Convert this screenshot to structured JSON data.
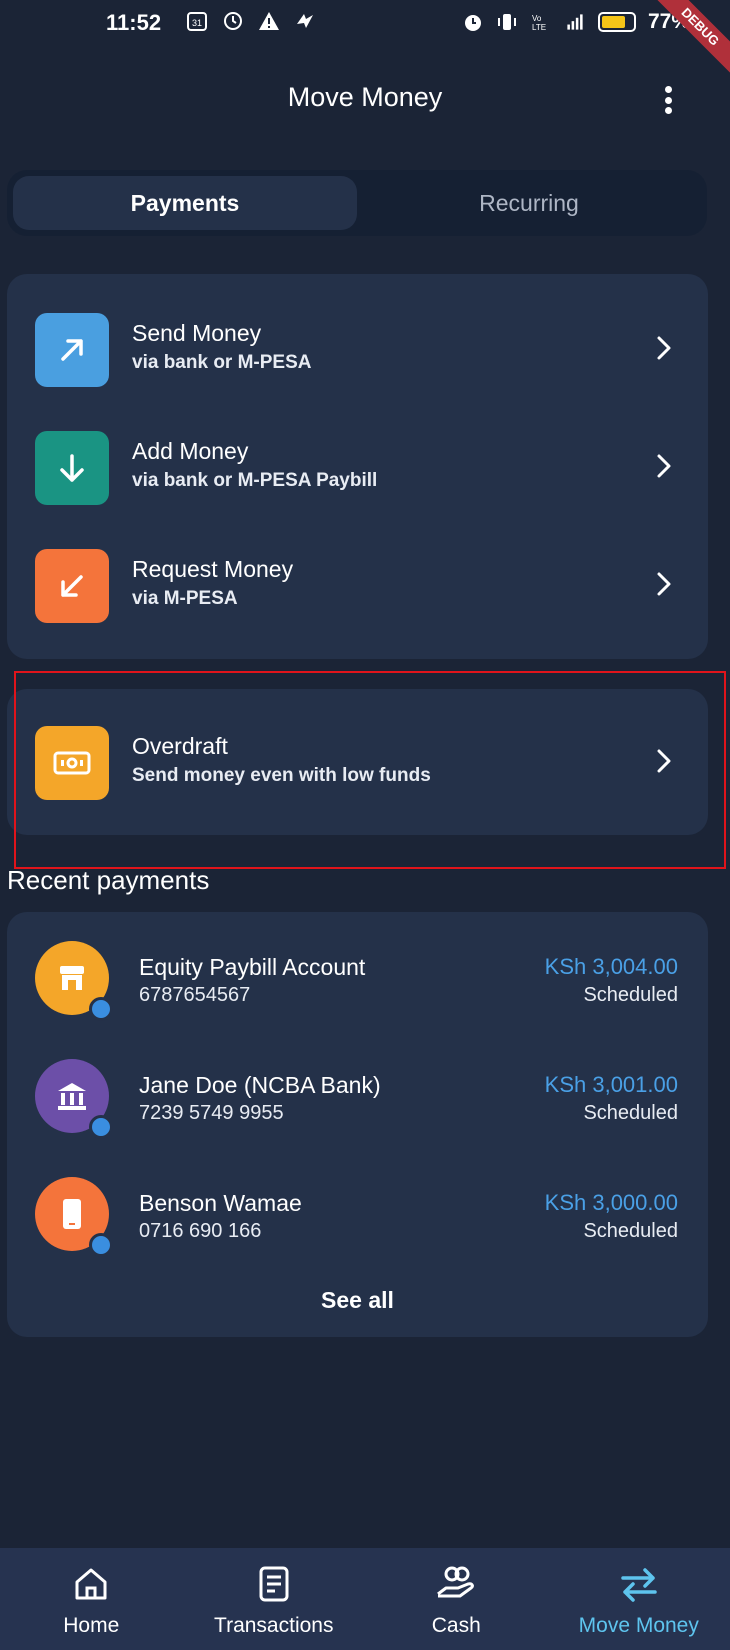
{
  "status_bar": {
    "time": "11:52",
    "battery": "77%",
    "battery_level": 0.77,
    "debug_label": "DEBUG",
    "left_icons": [
      "calendar-icon",
      "sync-icon",
      "warning-icon",
      "app-icon"
    ],
    "right_icons": [
      "alarm-icon",
      "vibrate-icon",
      "volte-icon",
      "signal-4g-icon",
      "battery-icon"
    ],
    "calendar_day": "31"
  },
  "header": {
    "title": "Move Money",
    "menu_icon": "more-vertical-icon"
  },
  "tabs": [
    {
      "label": "Payments",
      "active": true
    },
    {
      "label": "Recurring",
      "active": false
    }
  ],
  "actions": [
    {
      "title": "Send Money",
      "subtitle": "via bank or M-PESA",
      "icon": "arrow-up-right-icon",
      "color": "#4a9fe0"
    },
    {
      "title": "Add Money",
      "subtitle": "via bank or M-PESA Paybill",
      "icon": "arrow-down-icon",
      "color": "#1a9483"
    },
    {
      "title": "Request Money",
      "subtitle": "via M-PESA",
      "icon": "arrow-down-left-icon",
      "color": "#f4743b"
    }
  ],
  "overdraft": {
    "title": "Overdraft",
    "subtitle": "Send money even with low funds",
    "icon": "cash-icon",
    "color": "#f4a629"
  },
  "recent": {
    "title": "Recent payments",
    "see_all": "See all",
    "items": [
      {
        "name": "Equity Paybill Account",
        "account": "6787654567",
        "amount": "KSh 3,004.00",
        "status": "Scheduled",
        "icon": "store-icon",
        "color": "#f4a629"
      },
      {
        "name": "Jane Doe (NCBA Bank)",
        "account": "7239 5749 9955",
        "amount": "KSh 3,001.00",
        "status": "Scheduled",
        "icon": "bank-icon",
        "color": "#6c4fa8"
      },
      {
        "name": "Benson Wamae",
        "account": "0716 690 166",
        "amount": "KSh 3,000.00",
        "status": "Scheduled",
        "icon": "phone-icon",
        "color": "#f4743b"
      }
    ]
  },
  "nav": [
    {
      "label": "Home",
      "icon": "home-icon",
      "active": false
    },
    {
      "label": "Transactions",
      "icon": "receipt-icon",
      "active": false
    },
    {
      "label": "Cash",
      "icon": "cash-hand-icon",
      "active": false
    },
    {
      "label": "Move Money",
      "icon": "swap-arrows-icon",
      "active": true
    }
  ],
  "colors": {
    "background": "#1b2436",
    "card": "#243149",
    "accent": "#5ec4ee",
    "amount": "#4aa0e6",
    "highlight": "#e0141b"
  }
}
